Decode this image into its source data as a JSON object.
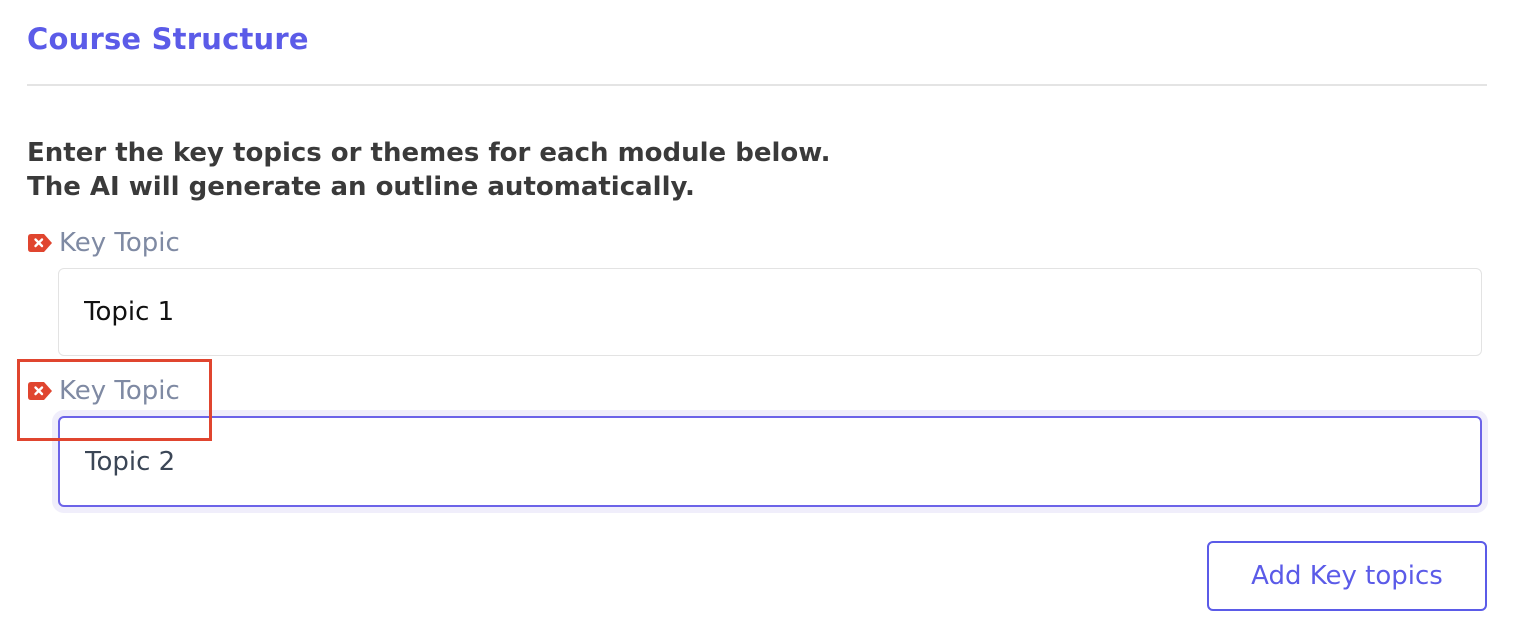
{
  "section": {
    "title": "Course Structure"
  },
  "instructions": {
    "line1": "Enter the key topics or themes for each module below.",
    "line2": "The AI will generate an outline automatically."
  },
  "topics": [
    {
      "label": "Key Topic",
      "value": "Topic 1",
      "remove_icon": "remove-tag-icon",
      "focused": false
    },
    {
      "label": "Key Topic",
      "value": "Topic 2",
      "remove_icon": "remove-tag-icon",
      "focused": true
    }
  ],
  "actions": {
    "add_label": "Add Key topics"
  },
  "colors": {
    "accent": "#5b5be8",
    "remove": "#e0452f",
    "label": "#7f8aa3",
    "highlight": "#e0452f"
  }
}
